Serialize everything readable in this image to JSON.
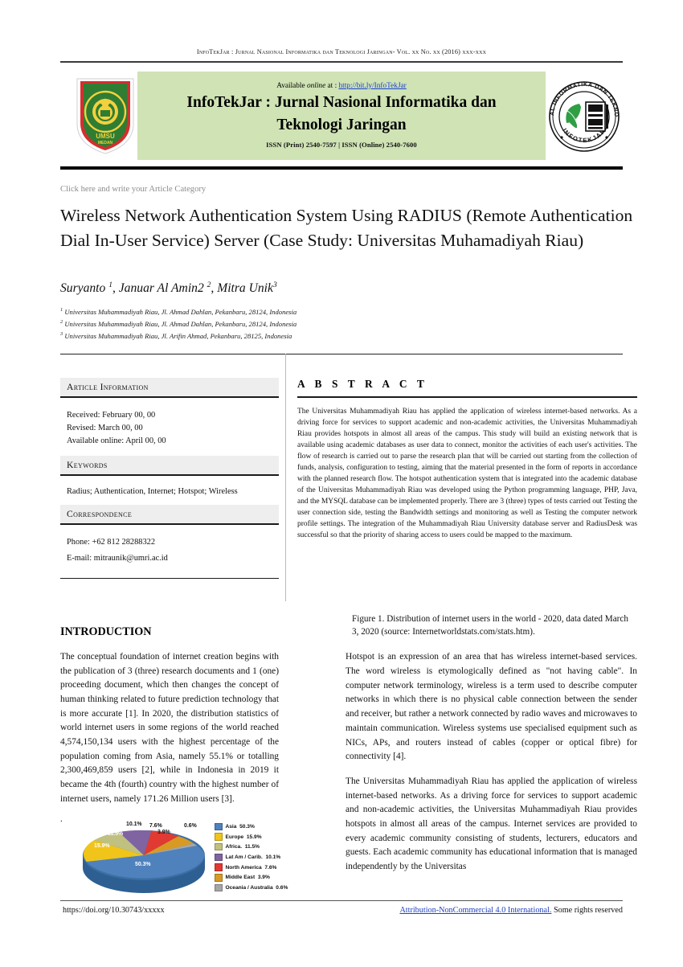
{
  "running_head": "InfoTekJar : Jurnal Nasional Informatika dan Teknologi Jaringan- Vol. xx No. xx (2016) xxx-xxx",
  "banner": {
    "available_prefix": "Available ",
    "available_italic": "online",
    "available_at": " at : ",
    "available_link": "http://bit.ly/InfoTekJar",
    "title_line1": "InfoTekJar : Jurnal Nasional Informatika dan",
    "title_line2": "Teknologi Jaringan",
    "issn": "ISSN (Print) 2540-7597    |    ISSN (Online) 2540-7600",
    "green_hex": "#cfe3b4",
    "left_logo_name": "universitas-muhammadiyah-riau-shield-logo",
    "right_logo_name": "infotekjar-circular-seal-logo",
    "seal_outer_text": "JURNAL NASIONAL INFORMATIKA DAN TEKNOLOGI JARINGAN",
    "seal_inner_text": "INFOTEKJAR"
  },
  "category_placeholder": "Click here and write your Article Category",
  "article": {
    "title": "Wireless Network Authentication System Using RADIUS (Remote Authentication Dial In-User Service) Server (Case Study: Universitas Muhamadiyah Riau)",
    "authors_plain": "Suryanto 1, Januar Al Amin2 2, Mitra Unik3",
    "affiliations": [
      {
        "sup": "1",
        "text": "Universitas Muhammadiyah Riau, Jl. Ahmad Dahlan, Pekanbaru, 28124, Indonesia"
      },
      {
        "sup": "2",
        "text": "Universitas Muhammadiyah Riau, Jl. Ahmad Dahlan, Pekanbaru, 28124, Indonesia"
      },
      {
        "sup": "3",
        "text": "Universitas Muhammadiyah Riau, Jl. Arifin Ahmad, Pekanbaru, 28125, Indonesia"
      }
    ]
  },
  "article_information": {
    "heading": "Article Information",
    "received": "Received: February 00, 00",
    "revised": "Revised: March 00, 00",
    "available_online": "Available online: April 00, 00"
  },
  "keywords": {
    "heading": "Keywords",
    "text": "Radius; Authentication, Internet; Hotspot; Wireless"
  },
  "correspondence": {
    "heading": "Correspondence",
    "phone": "Phone: +62 812 28288322",
    "email": "E-mail: mitraunik@umri.ac.id"
  },
  "abstract": {
    "heading": "A B S T R A C T",
    "text": "The Universitas Muhammadiyah Riau has applied the application of wireless internet-based networks. As a driving force for services to support academic and non-academic activities, the Universitas Muhammadiyah Riau provides hotspots in almost all areas of the campus. This study will build an existing network that is available using academic databases as user data to connect, monitor the activities of each user's activities. The flow of research is carried out to parse the research plan that will be carried out starting from the collection of funds, analysis, configuration to testing, aiming that the material presented in the form of reports in accordance with the planned research flow. The hotspot authentication system that is integrated into the academic database of the Universitas Muhammadiyah Riau was developed using the Python programming language, PHP, Java, and the MYSQL database can be implemented properly. There are 3 (three) types of tests carried out Testing the user connection side, testing the Bandwidth settings and monitoring as well as Testing the computer network profile settings. The integration of the Muhammadiyah Riau University database server and RadiusDesk was successful so that the priority of sharing access to users could be mapped to the maximum."
  },
  "introduction": {
    "heading": "INTRODUCTION",
    "paragraph1": "The conceptual foundation of internet creation begins with the publication of 3 (three) research documents and 1 (one) proceeding document, which then changes the concept of human thinking related to future prediction technology that is more accurate [1]. In 2020, the distribution statistics of world internet users in some regions of the world reached 4,574,150,134 users with the highest percentage of the population coming from Asia, namely 55.1% or totalling 2,300,469,859 users [2], while in Indonesia in 2019 it became the 4th (fourth) country with the highest number of internet users, namely 171.26 Million users [3].",
    "stray_dot": "."
  },
  "right_column": {
    "figure_caption": "Figure 1. Distribution of internet users in the world - 2020, data dated March 3, 2020 (source: Internetworldstats.com/stats.htm).",
    "paragraph1": "Hotspot is an expression of an area that has wireless internet-based services. The word wireless is etymologically defined as \"not having cable\". In computer network terminology, wireless is a term used to describe computer networks in which there is no physical cable connection between the sender and receiver, but rather a network connected by radio waves and microwaves to maintain communication. Wireless systems use specialised equipment such as NICs, APs, and routers instead of cables (copper or optical fibre) for connectivity [4].",
    "paragraph2": "The Universitas Muhammadiyah Riau has applied the application of wireless internet-based networks. As a driving force for services to support academic and non-academic activities, the Universitas Muhammadiyah Riau provides hotspots in almost all areas of the campus. Internet services are provided to every academic community consisting of students, lecturers, educators and guests. Each academic community has educational information that is managed independently by the Universitas"
  },
  "footer": {
    "doi": "https://doi.org/10.30743/xxxxx",
    "license_link": "Attribution-NonCommercial 4.0 International.",
    "license_rest": " Some rights reserved"
  },
  "chart_data": {
    "type": "pie",
    "title": "Distribution of internet users in the world - 2020",
    "legend_position": "right",
    "categories": [
      "Asia",
      "Europe",
      "Africa.",
      "Lat Am / Carib.",
      "North America",
      "Middle East",
      "Oceania / Australia"
    ],
    "values": [
      50.3,
      15.9,
      11.5,
      10.1,
      7.6,
      3.9,
      0.6
    ],
    "value_labels": [
      "50.3%",
      "15.9%",
      "11.5%",
      "10.1%",
      "7.6%",
      "3.9%",
      "0.6%"
    ],
    "legend_entries": [
      {
        "label": "Asia",
        "value": "50.3%",
        "color": "#4f81bd"
      },
      {
        "label": "Europe",
        "value": "15.9%",
        "color": "#f0c419"
      },
      {
        "label": "Africa.",
        "value": "11.5%",
        "color": "#c0c080"
      },
      {
        "label": "Lat Am / Carib.",
        "value": "10.1%",
        "color": "#8064a2"
      },
      {
        "label": "North America",
        "value": "7.6%",
        "color": "#e03a32"
      },
      {
        "label": "Middle East",
        "value": "3.9%",
        "color": "#d99a23"
      },
      {
        "label": "Oceania / Australia",
        "value": "0.6%",
        "color": "#a6a6a6"
      }
    ],
    "units": "percent of world internet users"
  }
}
